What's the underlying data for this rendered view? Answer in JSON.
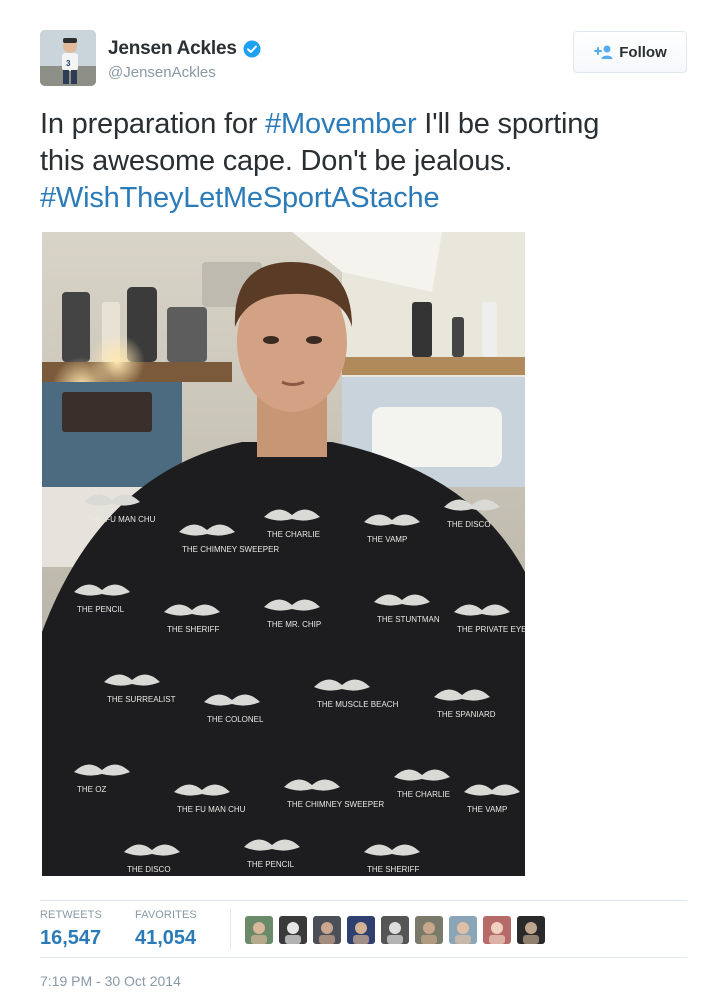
{
  "user": {
    "name": "Jensen Ackles",
    "handle": "@JensenAckles",
    "verified": true
  },
  "follow_button": {
    "label": "Follow",
    "icon": "add-user-icon"
  },
  "tweet": {
    "lines": [
      [
        {
          "text": "In preparation for "
        },
        {
          "text": "#Movember",
          "hashtag": true
        },
        {
          "text": " I'll be sporting"
        }
      ],
      [
        {
          "text": "this awesome cape.  Don't be jealous."
        }
      ],
      [
        {
          "text": "#WishTheyLetMeSportAStache",
          "hashtag": true
        }
      ]
    ]
  },
  "cape_labels": [
    "THE FU MAN CHU",
    "THE CHIMNEY SWEEPER",
    "THE CHARLIE",
    "THE VAMP",
    "THE DISCO",
    "THE PENCIL",
    "THE SHERIFF",
    "THE MR. CHIP",
    "THE STUNTMAN",
    "THE PRIVATE EYE",
    "THE SURREALIST",
    "THE COLONEL",
    "THE MUSCLE BEACH",
    "THE SPANIARD",
    "THE OZ"
  ],
  "stats": {
    "retweets": {
      "label": "RETWEETS",
      "value": "16,547"
    },
    "favorites": {
      "label": "FAVORITES",
      "value": "41,054"
    }
  },
  "favoriter_avatars": 9,
  "timestamp": "7:19 PM - 30 Oct 2014",
  "colors": {
    "link": "#2b7bb9",
    "text": "#292f33",
    "muted": "#8899a6",
    "border": "#e1e8ed"
  }
}
